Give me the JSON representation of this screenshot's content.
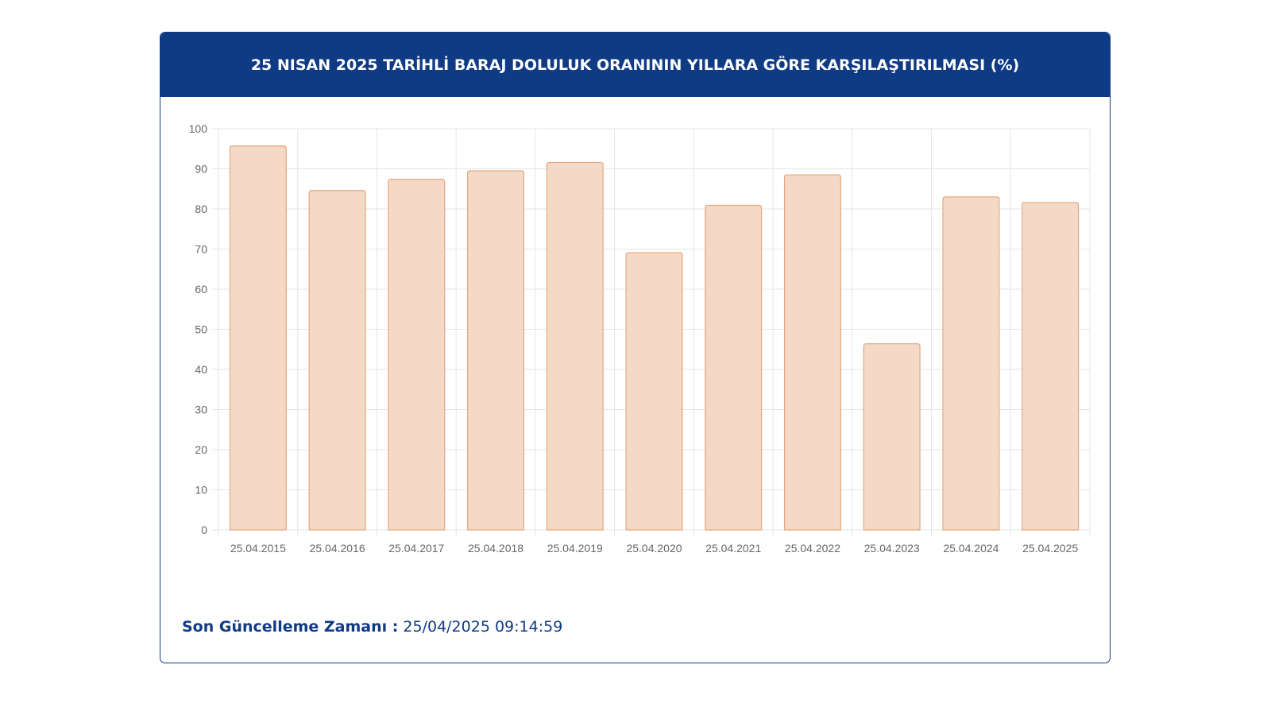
{
  "header": {
    "title": "25 NISAN 2025 TARİHLİ BARAJ DOLULUK ORANININ YILLARA GÖRE KARŞILAŞTIRILMASI (%)"
  },
  "footer": {
    "label": "Son Güncelleme Zamanı :",
    "value": " 25/04/2025 09:14:59"
  },
  "colors": {
    "header_bg": "#0f3a84",
    "bar_fill": "#f4d9c6",
    "bar_stroke": "#e3a882",
    "grid": "#e6e6e6",
    "tick_text": "#666666"
  },
  "chart_data": {
    "type": "bar",
    "title": "25 NISAN 2025 TARİHLİ BARAJ DOLULUK ORANININ YILLARA GÖRE KARŞILAŞTIRILMASI (%)",
    "xlabel": "",
    "ylabel": "",
    "categories": [
      "25.04.2015",
      "25.04.2016",
      "25.04.2017",
      "25.04.2018",
      "25.04.2019",
      "25.04.2020",
      "25.04.2021",
      "25.04.2022",
      "25.04.2023",
      "25.04.2024",
      "25.04.2025"
    ],
    "values": [
      95.7,
      84.6,
      87.4,
      89.5,
      91.6,
      69.1,
      80.9,
      88.5,
      46.4,
      83.0,
      81.6
    ],
    "ylim": [
      0,
      100
    ],
    "yticks": [
      0,
      10,
      20,
      30,
      40,
      50,
      60,
      70,
      80,
      90,
      100
    ],
    "grid": true,
    "legend": "none"
  }
}
